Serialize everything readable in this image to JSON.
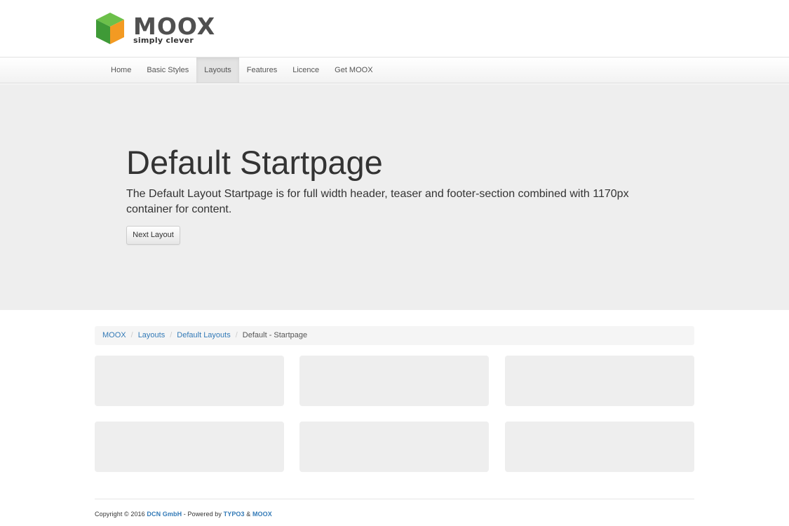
{
  "logo": {
    "name": "MOOX",
    "tagline": "simply clever",
    "colors": {
      "green": "#59b947",
      "green_dark": "#3c8f35",
      "orange": "#f39a22"
    }
  },
  "nav": {
    "items": [
      {
        "label": "Home"
      },
      {
        "label": "Basic Styles"
      },
      {
        "label": "Layouts",
        "active": true
      },
      {
        "label": "Features"
      },
      {
        "label": "Licence"
      },
      {
        "label": "Get MOOX"
      }
    ]
  },
  "hero": {
    "title": "Default Startpage",
    "text": "The Default Layout Startpage is for full width header, teaser and footer-section combined with 1170px container for content.",
    "button_label": "Next Layout"
  },
  "breadcrumb": {
    "items": [
      "MOOX",
      "Layouts",
      "Default Layouts"
    ],
    "separator": "/",
    "current": "Default - Startpage"
  },
  "footer": {
    "prefix": "Copyright © 2016 ",
    "company": "DCN GmbH",
    "powered": " - Powered by ",
    "typo3": "TYPO3",
    "amp": " & ",
    "moox": "MOOX"
  }
}
